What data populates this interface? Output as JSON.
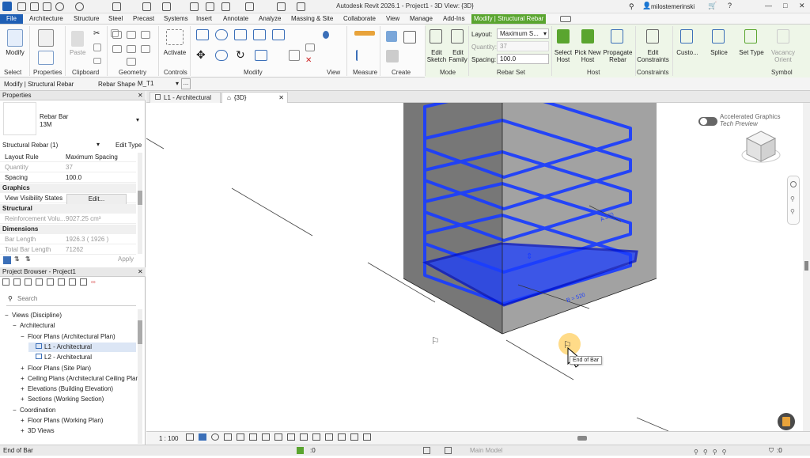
{
  "titlebar": {
    "title": "Autodesk Revit 2026.1 - Project1 - 3D View: {3D}",
    "user": "milostemerinski",
    "minimize": "—",
    "restore": "□",
    "close": "✕"
  },
  "tabs": {
    "file": "File",
    "items": [
      "Architecture",
      "Structure",
      "Steel",
      "Precast",
      "Systems",
      "Insert",
      "Annotate",
      "Analyze",
      "Massing & Site",
      "Collaborate",
      "View",
      "Manage",
      "Add-Ins"
    ],
    "contextual": "Modify | Structural Rebar"
  },
  "ribbon": {
    "panels": {
      "select": "Select",
      "properties": "Properties",
      "clipboard": "Clipboard",
      "geometry": "Geometry",
      "controls": "Controls",
      "modify": "Modify",
      "view": "View",
      "measure": "Measure",
      "create": "Create",
      "mode": "Mode",
      "rebar_set": "Rebar Set",
      "host": "Host",
      "constraints": "Constraints",
      "symbol": "Symbol"
    },
    "buttons": {
      "modify": "Modify",
      "activate": "Activate",
      "edit_sketch": [
        "Edit",
        "Sketch"
      ],
      "edit_family": [
        "Edit",
        "Family"
      ],
      "select_host": [
        "Select",
        "Host"
      ],
      "pick_new_host": [
        "Pick New",
        "Host"
      ],
      "propagate_rebar": [
        "Propagate",
        "Rebar"
      ],
      "edit_constraints": [
        "Edit",
        "Constraints"
      ],
      "custom": "Custo...",
      "splice": "Splice",
      "set_type": "Set Type",
      "vacancy_orient": [
        "Vacancy",
        "Orient"
      ]
    },
    "rebar_set": {
      "layout_label": "Layout:",
      "layout_value": "Maximum S...",
      "quantity_label": "Quantity:",
      "quantity_value": "37",
      "spacing_label": "Spacing:",
      "spacing_value": "100.0"
    }
  },
  "optionsbar": {
    "context": "Modify | Structural Rebar",
    "rebar_shape_label": "Rebar Shape :",
    "rebar_shape_value": "M_T1",
    "more": "..."
  },
  "properties": {
    "header": "Properties",
    "type_name": "Rebar Bar",
    "type_size": "13M",
    "selector": "Structural Rebar (1)",
    "edit_type": "Edit Type",
    "rows": [
      {
        "k": "Layout Rule",
        "v": "Maximum Spacing"
      },
      {
        "k": "Quantity",
        "v": "37"
      },
      {
        "k": "Spacing",
        "v": "100.0"
      }
    ],
    "graphics": "Graphics",
    "vv_states": "View Visibility States",
    "vv_edit": "Edit...",
    "structural": "Structural",
    "reinf_vol_k": "Reinforcement Volu...",
    "reinf_vol_v": "9027.25 cm³",
    "dimensions": "Dimensions",
    "bar_length_k": "Bar Length",
    "bar_length_v": "1926.3 ( 1926 )",
    "total_length_k": "Total Bar Length",
    "total_length_v": "71262",
    "apply": "Apply"
  },
  "browser": {
    "header": "Project Browser - Project1",
    "search_placeholder": "Search",
    "items": [
      {
        "label": "Views (Discipline)",
        "level": 0,
        "icon": "−"
      },
      {
        "label": "Architectural",
        "level": 1,
        "icon": "−"
      },
      {
        "label": "Floor Plans (Architectural Plan)",
        "level": 2,
        "icon": "−"
      },
      {
        "label": "L1 - Architectural",
        "level": 3,
        "icon": ""
      },
      {
        "label": "L2 - Architectural",
        "level": 3,
        "icon": ""
      },
      {
        "label": "Floor Plans (Site Plan)",
        "level": 2,
        "icon": "+"
      },
      {
        "label": "Ceiling Plans (Architectural Ceiling Plan",
        "level": 2,
        "icon": "+"
      },
      {
        "label": "Elevations (Building Elevation)",
        "level": 2,
        "icon": "+"
      },
      {
        "label": "Sections (Working Section)",
        "level": 2,
        "icon": "+"
      },
      {
        "label": "Coordination",
        "level": 1,
        "icon": "−"
      },
      {
        "label": "Floor Plans (Working Plan)",
        "level": 2,
        "icon": "+"
      },
      {
        "label": "3D Views",
        "level": 2,
        "icon": "+"
      }
    ]
  },
  "viewtabs": {
    "tab1": "L1 - Architectural",
    "tab2": "{3D}",
    "close": "✕"
  },
  "canvas": {
    "graphics_title": "Accelerated Graphics",
    "graphics_sub": "Tech Preview",
    "dim_b": "B = 520",
    "dim_a": "A 370",
    "tooltip": "End of Bar"
  },
  "viewctrl": {
    "scale": "1 : 100"
  },
  "statusbar": {
    "message": "End of Bar",
    "model": "Main Model",
    "zero": ":0"
  },
  "colors": {
    "accent": "#1f5fb5",
    "context_tab": "#5aa52f",
    "rebar": "#1a3dff",
    "concrete": "#8a8a8a"
  }
}
